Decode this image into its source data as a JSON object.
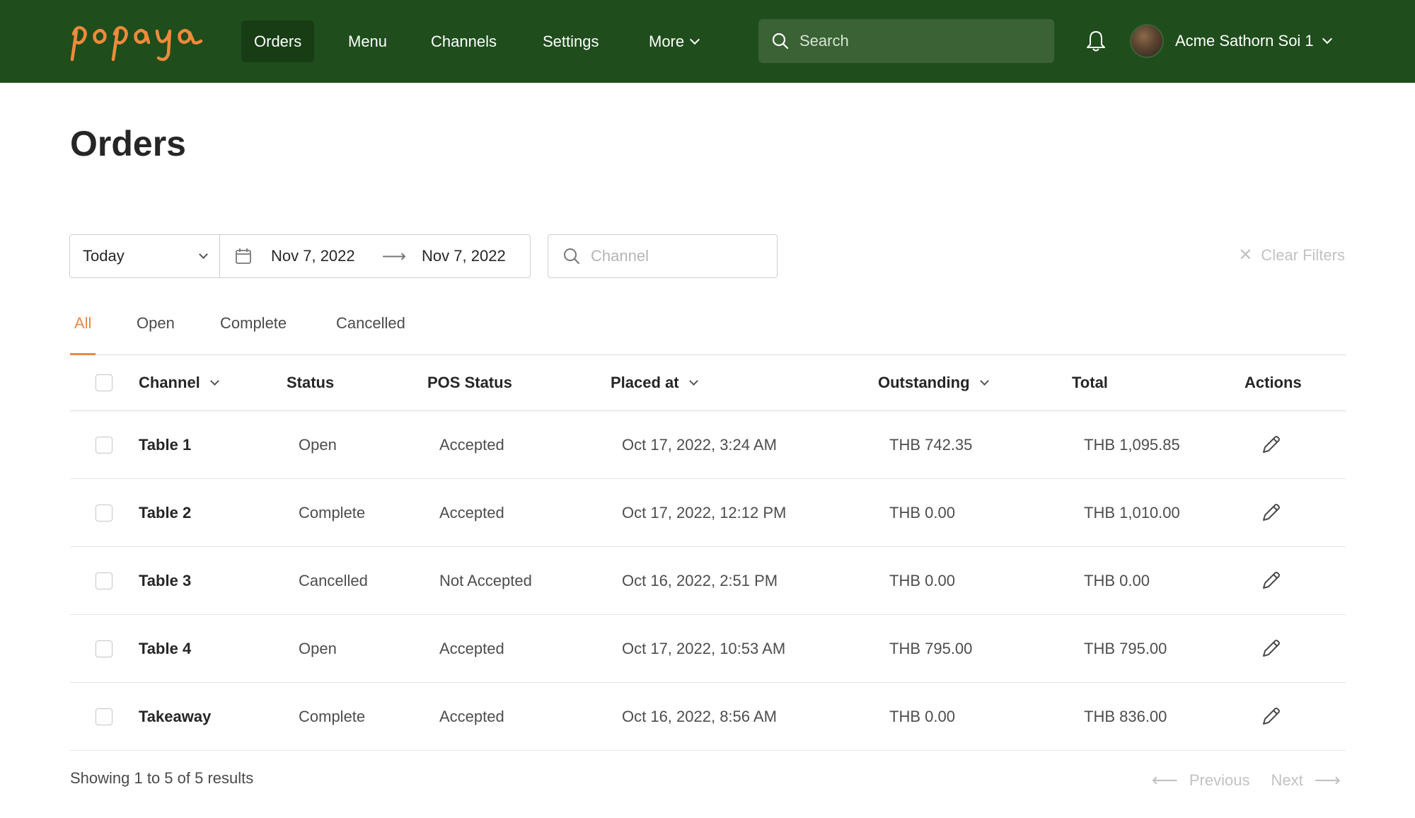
{
  "brand": {
    "logo_text": "papaya",
    "logo_color": "#f08a3c",
    "header_bg": "#1f4d1c"
  },
  "nav": {
    "items": [
      {
        "label": "Orders",
        "active": true
      },
      {
        "label": "Menu"
      },
      {
        "label": "Channels"
      },
      {
        "label": "Settings"
      },
      {
        "label": "More"
      }
    ]
  },
  "search": {
    "placeholder": "Search"
  },
  "user": {
    "name": "Acme Sathorn Soi 1",
    "icon": "bell-icon"
  },
  "page": {
    "title": "Orders"
  },
  "filters": {
    "range": "Today",
    "date_from": "Nov 7, 2022",
    "date_to": "Nov 7, 2022",
    "channel_placeholder": "Channel",
    "clear_label": "Clear Filters"
  },
  "tabs": [
    {
      "label": "All",
      "active": true
    },
    {
      "label": "Open"
    },
    {
      "label": "Complete"
    },
    {
      "label": "Cancelled"
    }
  ],
  "table": {
    "columns": {
      "channel": "Channel",
      "status": "Status",
      "pos_status": "POS Status",
      "placed_at": "Placed at",
      "outstanding": "Outstanding",
      "total": "Total",
      "actions": "Actions"
    },
    "rows": [
      {
        "channel": "Table 1",
        "status": "Open",
        "pos_status": "Accepted",
        "placed_at": "Oct 17, 2022, 3:24 AM",
        "outstanding": "THB 742.35",
        "total": "THB 1,095.85"
      },
      {
        "channel": "Table 2",
        "status": "Complete",
        "pos_status": "Accepted",
        "placed_at": "Oct 17, 2022, 12:12 PM",
        "outstanding": "THB 0.00",
        "total": "THB 1,010.00"
      },
      {
        "channel": "Table 3",
        "status": "Cancelled",
        "pos_status": "Not Accepted",
        "placed_at": "Oct 16, 2022, 2:51 PM",
        "outstanding": "THB 0.00",
        "total": "THB 0.00"
      },
      {
        "channel": "Table 4",
        "status": "Open",
        "pos_status": "Accepted",
        "placed_at": "Oct 17, 2022, 10:53 AM",
        "outstanding": "THB 795.00",
        "total": "THB 795.00"
      },
      {
        "channel": "Takeaway",
        "status": "Complete",
        "pos_status": "Accepted",
        "placed_at": "Oct 16, 2022, 8:56 AM",
        "outstanding": "THB 0.00",
        "total": "THB 836.00"
      }
    ]
  },
  "footer": {
    "results_text": "Showing 1 to 5 of 5 results",
    "prev_label": "Previous",
    "next_label": "Next"
  },
  "colors": {
    "accent": "#ee8744",
    "muted": "#c2c2c2",
    "border": "#cfcfcf"
  }
}
